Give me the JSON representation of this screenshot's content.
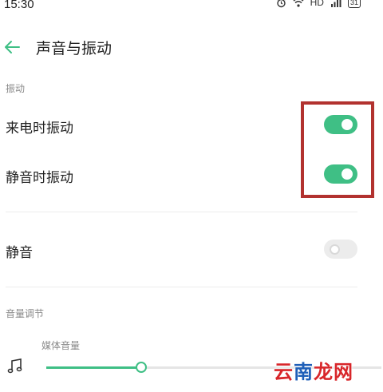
{
  "status_bar": {
    "time": "15:30",
    "icons": [
      "alarm-icon",
      "wifi-icon",
      "hd-icon",
      "signal-icon"
    ],
    "hd_label": "HD",
    "battery": "31"
  },
  "header": {
    "title": "声音与振动",
    "back_icon": "arrow-left-icon"
  },
  "vibration_section": {
    "title": "振动",
    "items": [
      {
        "label": "来电时振动",
        "enabled": true
      },
      {
        "label": "静音时振动",
        "enabled": true
      }
    ]
  },
  "mute": {
    "label": "静音",
    "enabled": false
  },
  "volume_section": {
    "title": "音量调节",
    "media_label": "媒体音量",
    "media_level": 0.28,
    "icon": "music-note-icon"
  },
  "watermark": {
    "part1": "云",
    "part2": "南",
    "part3": "龙网"
  },
  "colors": {
    "accent": "#3fbf85",
    "highlight": "#b2322f",
    "muted_text": "#8a8a8a"
  }
}
